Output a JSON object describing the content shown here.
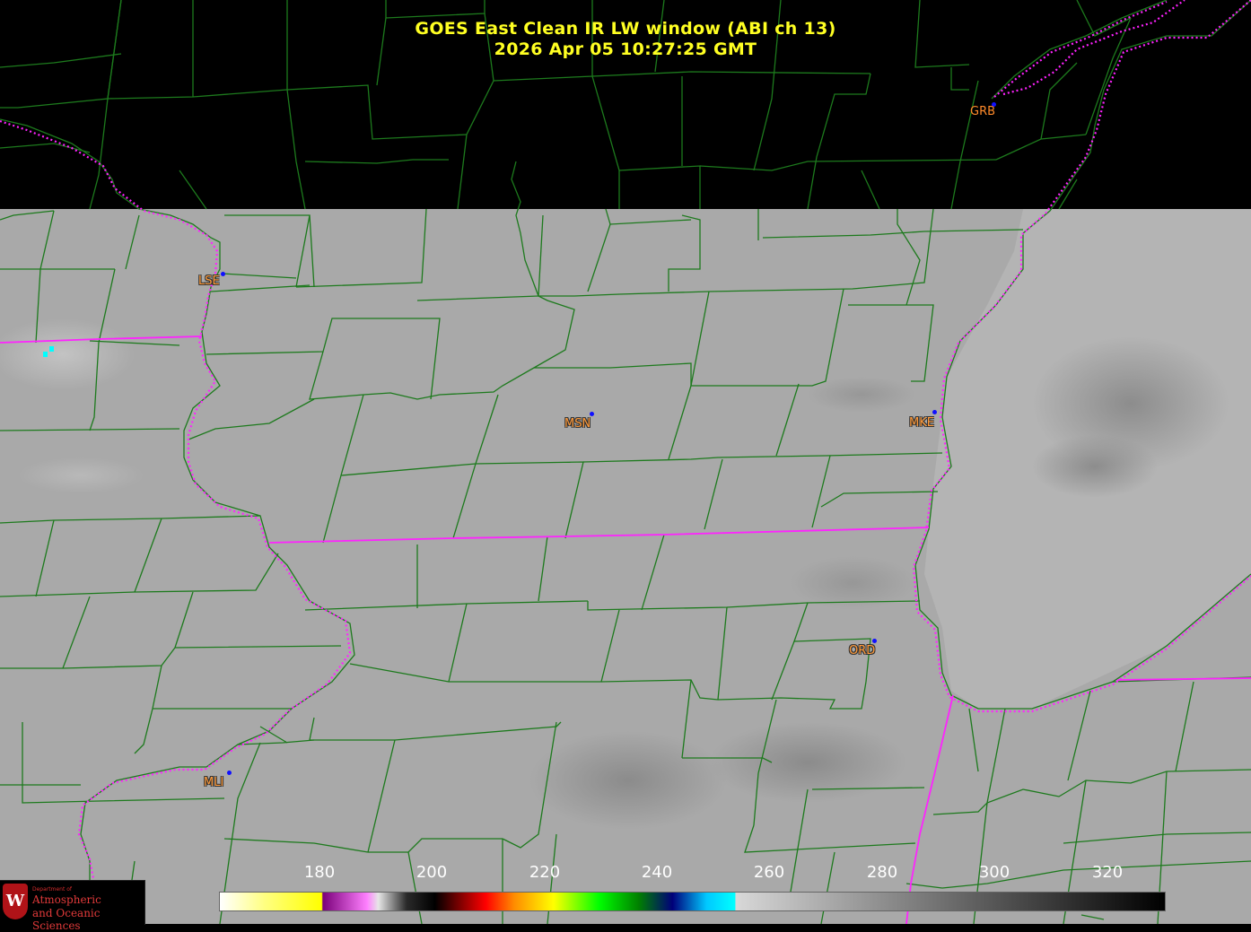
{
  "title": {
    "line1": "GOES East Clean IR LW window (ABI ch 13)",
    "line2": "2026 Apr 05  10:27:25 GMT"
  },
  "stations": [
    {
      "id": "GRB",
      "label": "GRB"
    },
    {
      "id": "LSE",
      "label": "LSE"
    },
    {
      "id": "MSN",
      "label": "MSN"
    },
    {
      "id": "MKE",
      "label": "MKE"
    },
    {
      "id": "ORD",
      "label": "ORD"
    },
    {
      "id": "MLI",
      "label": "MLI"
    }
  ],
  "colorbar": {
    "ticks": [
      "180",
      "200",
      "220",
      "240",
      "260",
      "280",
      "300",
      "320"
    ],
    "range": [
      163,
      330
    ],
    "stops": [
      {
        "v": 163,
        "c": "#ffffff"
      },
      {
        "v": 171,
        "c": "#ffff80"
      },
      {
        "v": 181,
        "c": "#ffff00"
      },
      {
        "v": 181.2,
        "c": "#7a007a"
      },
      {
        "v": 189,
        "c": "#ff80ff"
      },
      {
        "v": 191,
        "c": "#e6e6e6"
      },
      {
        "v": 196,
        "c": "#2a2a2a"
      },
      {
        "v": 201,
        "c": "#000000"
      },
      {
        "v": 210,
        "c": "#ff0000"
      },
      {
        "v": 215,
        "c": "#ff8c00"
      },
      {
        "v": 222,
        "c": "#ffff00"
      },
      {
        "v": 230,
        "c": "#00ff00"
      },
      {
        "v": 237,
        "c": "#008000"
      },
      {
        "v": 243,
        "c": "#00007a"
      },
      {
        "v": 249,
        "c": "#00c8ff"
      },
      {
        "v": 254,
        "c": "#00ffff"
      },
      {
        "v": 254.2,
        "c": "#d8d8d8"
      },
      {
        "v": 330,
        "c": "#000000"
      }
    ]
  },
  "logo": {
    "dept_text": "Department of",
    "line1": "Atmospheric",
    "line2": "and Oceanic Sciences",
    "shield_letter": "W"
  },
  "colors": {
    "county_lines": "#1d7a1d",
    "state_lines": "#ff22ff",
    "title_text": "#ffff22",
    "station_text": "#ff9a3a",
    "station_dot": "#1010ff"
  }
}
